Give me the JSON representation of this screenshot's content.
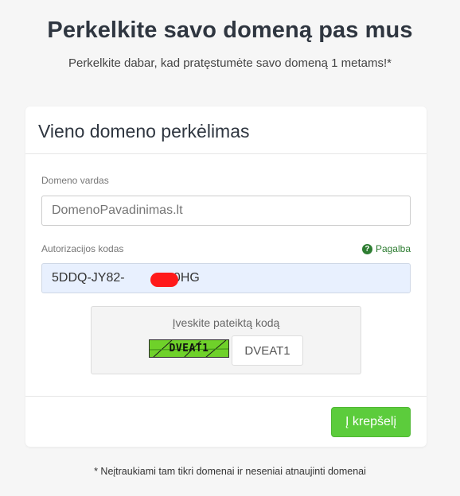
{
  "page": {
    "title": "Perkelkite savo domeną pas mus",
    "subtitle": "Perkelkite dabar, kad pratęstumėte savo domeną 1 metams!*",
    "footnote": "* Neįtraukiami tam tikri domenai ir neseniai atnaujinti domenai"
  },
  "card": {
    "title": "Vieno domeno perkėlimas",
    "domain_field": {
      "label": "Domeno vardas",
      "value": "",
      "placeholder": "DomenoPavadinimas.lt"
    },
    "auth_field": {
      "label": "Autorizacijos kodas",
      "value": "5DDQ-JY82-          -D0HG",
      "help_label": "Pagalba",
      "help_icon": "question-circle-icon"
    },
    "captcha": {
      "label": "Įveskite pateiktą kodą",
      "image_text": "DVEAT1",
      "input_value": "DVEAT1"
    },
    "submit_label": "Į krepšelį"
  },
  "colors": {
    "accent_green": "#5ccc3c",
    "help_green": "#2e7d32",
    "autofill_bg": "#e8f0fe",
    "redaction_red": "#ff1a1a"
  }
}
